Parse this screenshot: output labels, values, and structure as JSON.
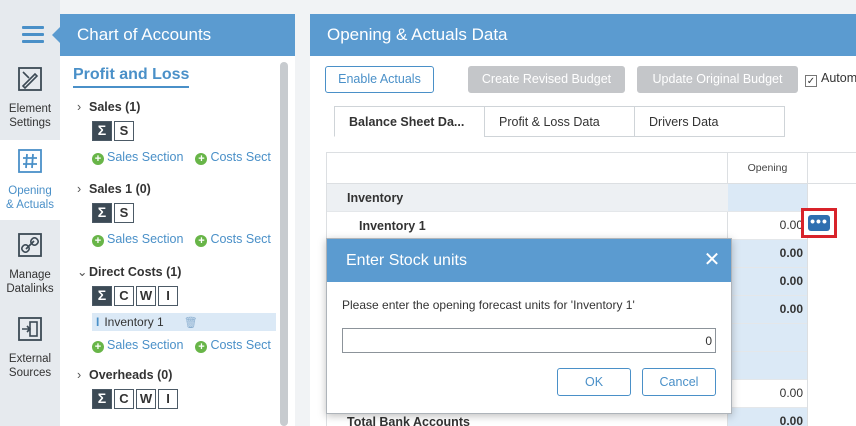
{
  "nav": {
    "items": [
      {
        "label1": "Element",
        "label2": "Settings",
        "icon": "pencil-ruler-icon"
      },
      {
        "label1": "Opening",
        "label2": "& Actuals",
        "icon": "hash-icon"
      },
      {
        "label1": "Manage",
        "label2": "Datalinks",
        "icon": "link-icon"
      },
      {
        "label1": "External",
        "label2": "Sources",
        "icon": "import-icon"
      }
    ]
  },
  "coa": {
    "title": "Chart of Accounts",
    "pl_title": "Profit and Loss",
    "groups": [
      {
        "title": "Sales (1)",
        "buttons": [
          "Σ",
          "S"
        ],
        "add1": "Sales Section",
        "add2": "Costs Sect"
      },
      {
        "title": "Sales 1 (0)",
        "buttons": [
          "Σ",
          "S"
        ],
        "add1": "Sales Section",
        "add2": "Costs Sect"
      },
      {
        "title": "Direct Costs (1)",
        "buttons": [
          "Σ",
          "C",
          "W",
          "I"
        ],
        "item": "Inventory 1",
        "add1": "Sales Section",
        "add2": "Costs Sect"
      },
      {
        "title": "Overheads (0)",
        "buttons": [
          "Σ",
          "C",
          "W",
          "I"
        ]
      }
    ]
  },
  "main": {
    "title": "Opening & Actuals Data",
    "buttons": {
      "enable_actuals": "Enable Actuals",
      "create_revised": "Create Revised Budget",
      "update_original": "Update Original Budget",
      "auto": "Autom"
    },
    "tabs": [
      "Balance Sheet Da...",
      "Profit & Loss Data",
      "Drivers Data"
    ],
    "grid": {
      "col_opening": "Opening",
      "rows": {
        "inventory": "Inventory",
        "inventory1": "Inventory 1",
        "inventory1_val": "0.00",
        "r3_val": "0.00",
        "r4_val": "0.00",
        "r5_val": "0.00",
        "r6_val": "0.00",
        "total_bank": "Total Bank Accounts",
        "total_bank_val": "0.00"
      }
    }
  },
  "modal": {
    "title": "Enter Stock units",
    "message": "Please enter the opening forecast units for 'Inventory 1'",
    "input_value": "0",
    "ok": "OK",
    "cancel": "Cancel"
  }
}
